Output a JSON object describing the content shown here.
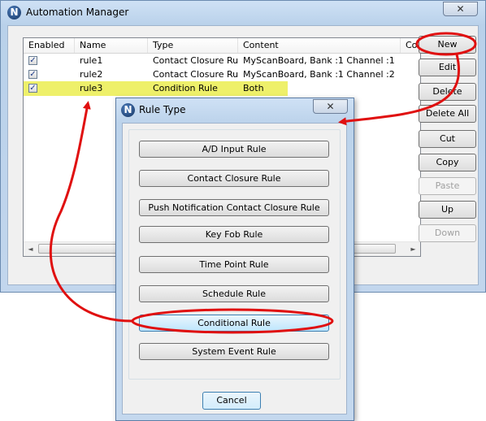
{
  "main_window": {
    "title": "Automation Manager",
    "close_glyph": "✕",
    "logo_glyph": "N",
    "list": {
      "columns": [
        "Enabled",
        "Name",
        "Type",
        "Content",
        "Co"
      ],
      "rows": [
        {
          "enabled": true,
          "name": "rule1",
          "type": "Contact Closure Rule",
          "content": "MyScanBoard, Bank :1 Channel :1",
          "highlighted": false
        },
        {
          "enabled": true,
          "name": "rule2",
          "type": "Contact Closure Rule",
          "content": "MyScanBoard, Bank :1 Channel :2",
          "highlighted": false
        },
        {
          "enabled": true,
          "name": "rule3",
          "type": "Condition Rule",
          "content": "Both",
          "highlighted": true
        }
      ],
      "scroll_left_glyph": "◄",
      "scroll_right_glyph": "►"
    },
    "buttons": {
      "new": "New",
      "edit": "Edit",
      "delete": "Delete",
      "delete_all": "Delete All",
      "cut": "Cut",
      "copy": "Copy",
      "paste": "Paste",
      "up": "Up",
      "down": "Down"
    }
  },
  "dialog": {
    "title": "Rule Type",
    "logo_glyph": "N",
    "close_glyph": "✕",
    "rule_buttons": [
      "A/D Input Rule",
      "Contact Closure Rule",
      "Push Notification Contact Closure Rule",
      "Key Fob Rule",
      "Time Point Rule",
      "Schedule Rule",
      "Conditional Rule",
      "System Event Rule"
    ],
    "cancel": "Cancel"
  },
  "colors": {
    "highlight": "#eef06a",
    "annotation_red": "#e01010"
  }
}
